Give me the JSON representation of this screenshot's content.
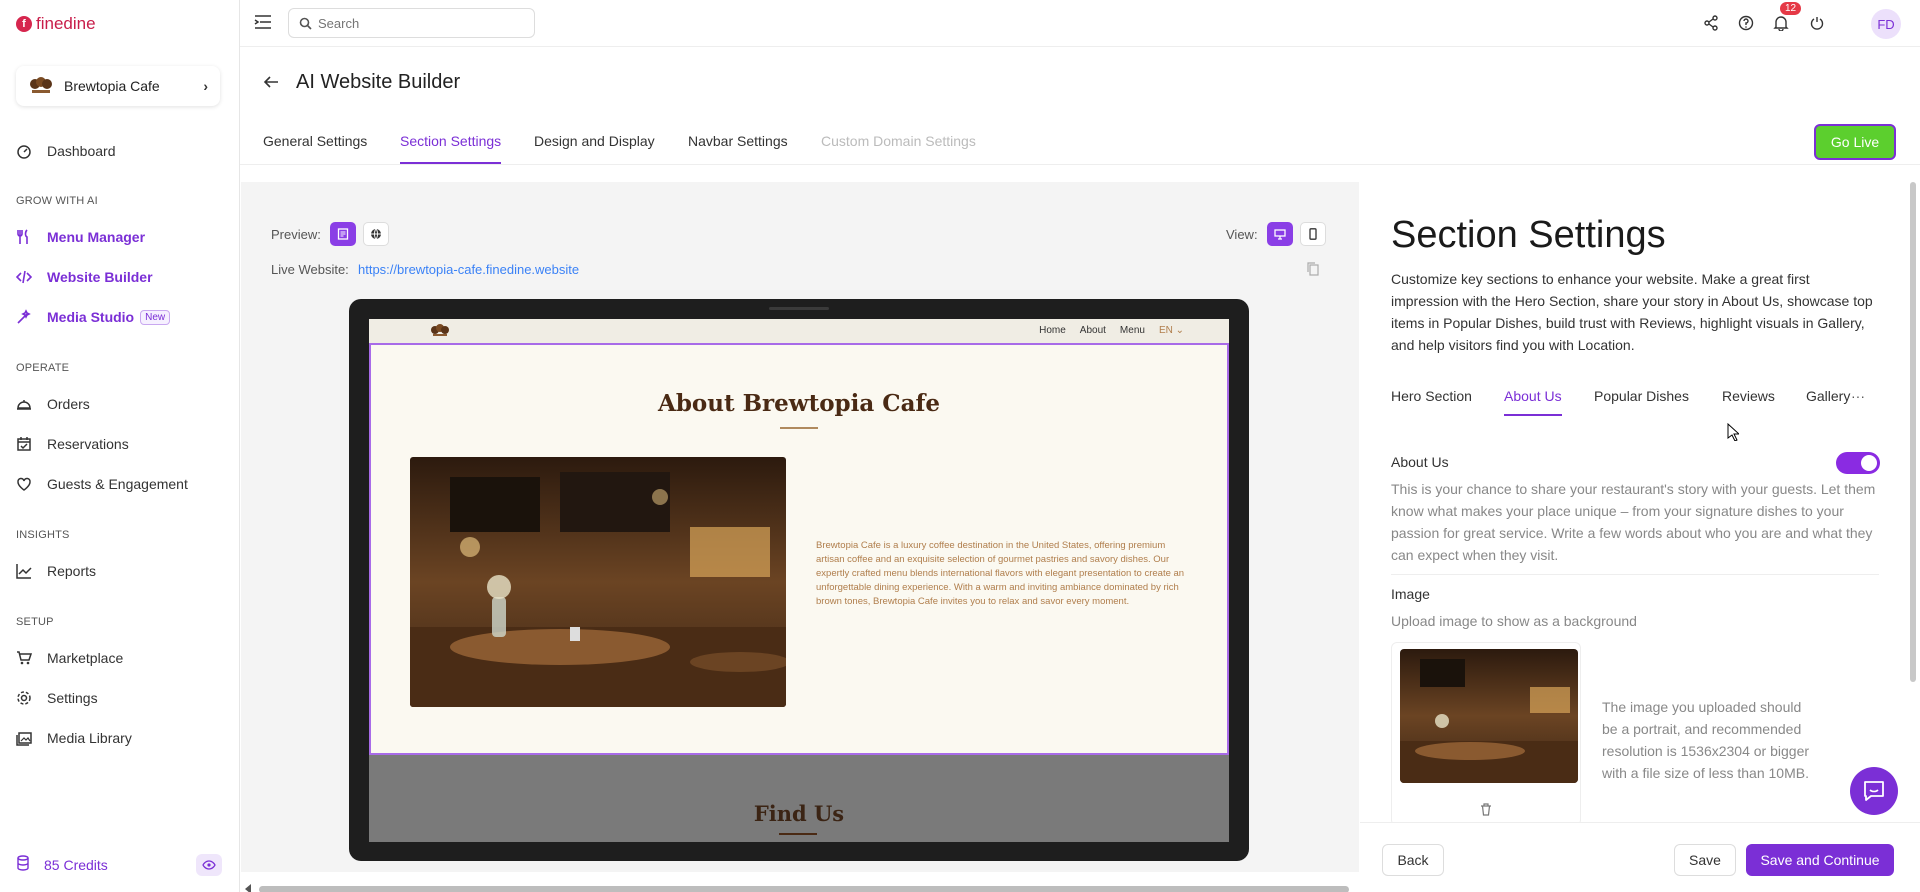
{
  "app": {
    "logo_mark": "f",
    "logo_text": "finedine"
  },
  "venue": {
    "name": "Brewtopia Cafe",
    "chevron": "›"
  },
  "sidebar": {
    "dashboard": "Dashboard",
    "grow_heading": "GROW WITH AI",
    "menu_manager": "Menu Manager",
    "website_builder": "Website Builder",
    "media_studio": "Media Studio",
    "new_badge": "New",
    "operate_heading": "OPERATE",
    "orders": "Orders",
    "reservations": "Reservations",
    "guests": "Guests & Engagement",
    "insights_heading": "INSIGHTS",
    "reports": "Reports",
    "setup_heading": "SETUP",
    "marketplace": "Marketplace",
    "settings": "Settings",
    "media_library": "Media Library",
    "credits": "85 Credits"
  },
  "topbar": {
    "search_placeholder": "Search",
    "notification_count": "12",
    "avatar_initials": "FD"
  },
  "header": {
    "title": "AI Website Builder"
  },
  "tabs": {
    "general": "General Settings",
    "section": "Section Settings",
    "design": "Design and Display",
    "navbar": "Navbar Settings",
    "domain": "Custom Domain Settings"
  },
  "go_live": "Go Live",
  "preview": {
    "label": "Preview:",
    "view_label": "View:",
    "live_label": "Live Website:",
    "live_url": "https://brewtopia-cafe.finedine.website",
    "site_nav": {
      "home": "Home",
      "about": "About",
      "menu": "Menu",
      "lang": "EN ⌄"
    },
    "about_title": "About Brewtopia Cafe",
    "about_text": "Brewtopia Cafe is a luxury coffee destination in the United States, offering premium artisan coffee and an exquisite selection of gourmet pastries and savory dishes. Our expertly crafted menu blends international flavors with elegant presentation to create an unforgettable dining experience. With a warm and inviting ambiance dominated by rich brown tones, Brewtopia Cafe invites you to relax and savor every moment.",
    "find_title": "Find Us"
  },
  "panel": {
    "title": "Section Settings",
    "description": "Customize key sections to enhance your website. Make a great first impression with the Hero Section, share your story in About Us, showcase top items in Popular Dishes, build trust with Reviews, highlight visuals in Gallery, and help visitors find you with Location.",
    "section_tabs": {
      "hero": "Hero Section",
      "about": "About Us",
      "popular": "Popular Dishes",
      "reviews": "Reviews",
      "gallery": "Gallery"
    },
    "more": "···",
    "about_label": "About Us",
    "about_help": "This is your chance to share your restaurant's story with your guests. Let them know what makes your place unique – from your signature dishes to your passion for great service. Write a few words about who you are and what they can expect when they visit.",
    "about_enabled": true,
    "image_label": "Image",
    "image_help": "Upload image to show as a background",
    "image_note": "The image you uploaded should be a portrait, and recommended resolution is 1536x2304 or bigger with a file size of less than 10MB."
  },
  "footer": {
    "back": "Back",
    "save": "Save",
    "save_continue": "Save and Continue"
  },
  "colors": {
    "accent": "#7b2fd6",
    "go_live": "#5ccf2e",
    "brand": "#c81d4a"
  }
}
